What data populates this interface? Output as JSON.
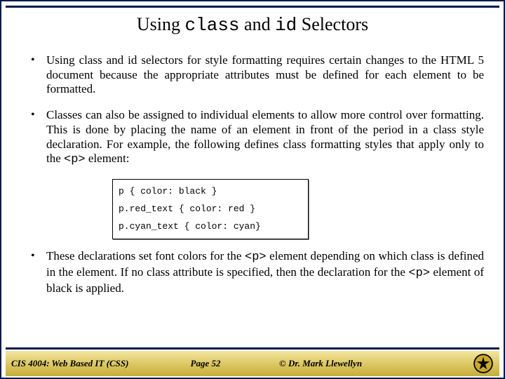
{
  "title": {
    "pre": "Using ",
    "m1": "class",
    "mid": " and ",
    "m2": "id",
    "post": " Selectors"
  },
  "bullets": {
    "b1": "Using class and id selectors for style formatting requires certain changes to the HTML 5 document because the appropriate attributes must be defined for each element to be formatted.",
    "b2a": "Classes can also be assigned to individual elements to allow more control over formatting.  This is done by placing the name of an element in front of the period in a class style declaration.  For example, the following defines class formatting styles that apply only to the ",
    "b2m": "<p>",
    "b2b": " element:",
    "b3a": "These declarations set font colors for the ",
    "b3m1": "<p>",
    "b3b": " element depending on which class is defined in the element.  If no class attribute is specified, then the declaration for the ",
    "b3m2": "<p>",
    "b3c": " element of black is applied."
  },
  "code": {
    "l1": "p           { color: black }",
    "l2": "p.red_text  { color: red }",
    "l3": "p.cyan_text { color: cyan}"
  },
  "footer": {
    "course": "CIS 4004: Web Based IT (CSS)",
    "page": "Page 52",
    "author": "© Dr. Mark Llewellyn"
  }
}
